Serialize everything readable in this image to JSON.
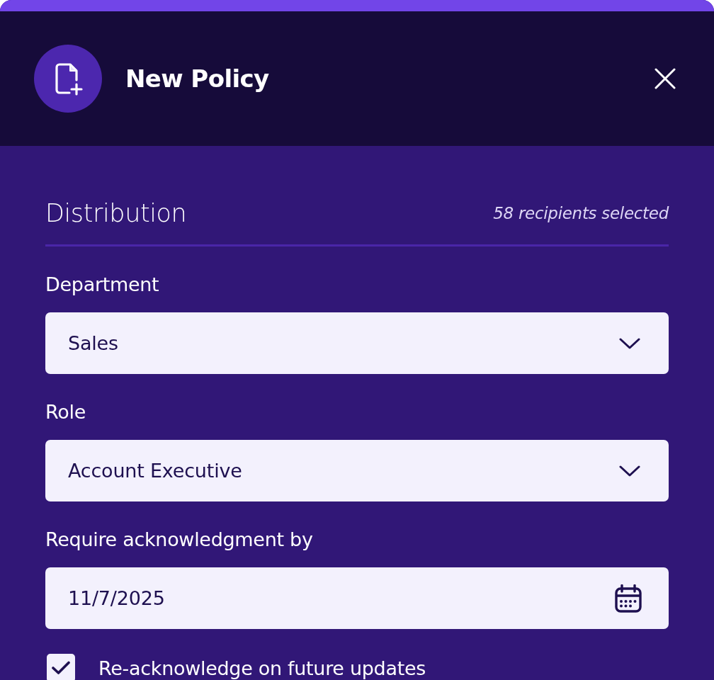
{
  "dialog": {
    "title": "New Policy",
    "section": {
      "title": "Distribution",
      "count": "58 recipients selected"
    },
    "fields": [
      {
        "kind": "select",
        "label": "Department",
        "value": "Sales"
      },
      {
        "kind": "select",
        "label": "Role",
        "value": "Account Executive"
      },
      {
        "kind": "date",
        "label": "Require acknowledgment by",
        "value": "11/7/2025"
      }
    ],
    "checkboxes": [
      {
        "label": "Re-acknowledge on future updates",
        "checked": true
      }
    ]
  }
}
